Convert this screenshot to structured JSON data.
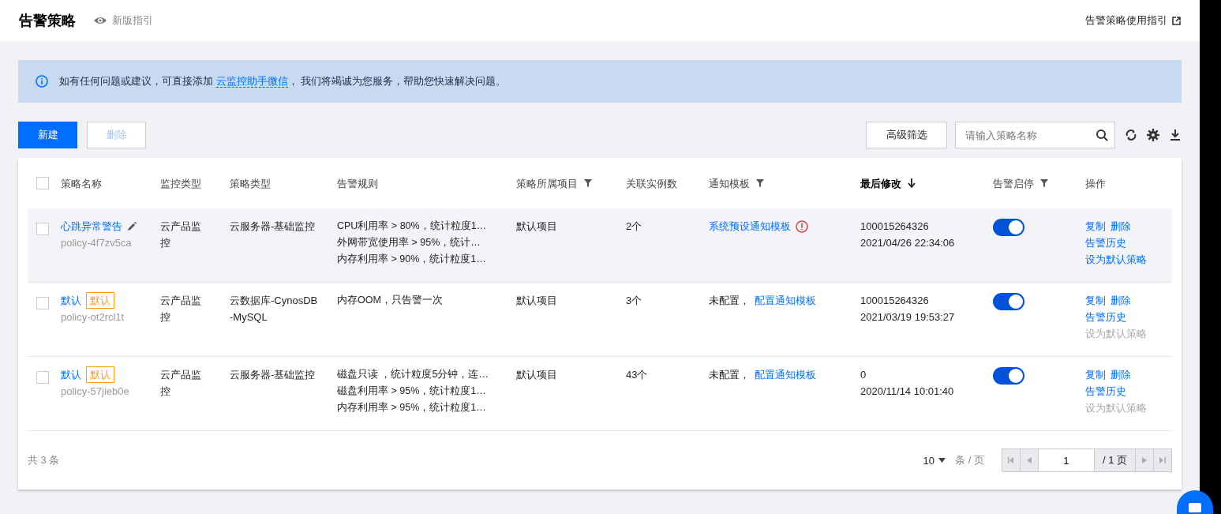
{
  "header": {
    "title": "告警策略",
    "guide_link": "新版指引",
    "help_link": "告警策略使用指引"
  },
  "notice": {
    "before": "如有任何问题或建议，可直接添加",
    "link": "云监控助手微信",
    "after": "，  我们将竭诚为您服务，帮助您快速解决问题。"
  },
  "toolbar": {
    "create": "新建",
    "delete": {
      "label": "删除",
      "disabled": true
    },
    "filter": "高级筛选",
    "search": {
      "placeholder": "请输入策略名称"
    }
  },
  "table": {
    "all_checked": false,
    "columns": [
      {
        "label": "策略名称",
        "kind": "plain"
      },
      {
        "label": "监控类型",
        "kind": "plain"
      },
      {
        "label": "策略类型",
        "kind": "plain"
      },
      {
        "label": "告警规则",
        "kind": "plain"
      },
      {
        "label": "策略所属项目",
        "kind": "filter"
      },
      {
        "label": "关联实例数",
        "kind": "plain"
      },
      {
        "label": "通知模板",
        "kind": "filter"
      },
      {
        "label": "最后修改",
        "kind": "sort"
      },
      {
        "label": "告警启停",
        "kind": "filter"
      },
      {
        "label": "操作",
        "kind": "plain"
      }
    ],
    "rows": [
      {
        "hovered": true,
        "checked": false,
        "name": "心跳异常警告",
        "editable": true,
        "id": "policy-4f7zv5ca",
        "monitor_type": "云产品监控",
        "policy_type": "云服务器-基础监控",
        "rules": [
          "CPU利用率 > 80%，统计粒度1…",
          "外网带宽使用率 > 95%，统计…",
          "内存利用率 > 90%，统计粒度1…"
        ],
        "project": "默认项目",
        "instances": "2个",
        "template": {
          "link": "系统预设通知模板",
          "warning": true
        },
        "modifier": "100015264326",
        "modified": "2021/04/26 22:34:06",
        "enabled": true,
        "actions": {
          "copy": "复制",
          "delete": "删除",
          "history": "告警历史",
          "set_default": {
            "label": "设为默认策略",
            "disabled": false
          }
        }
      },
      {
        "hovered": false,
        "checked": false,
        "name": "默认",
        "tag": "默认",
        "id": "policy-ot2rcl1t",
        "monitor_type": "云产品监控",
        "policy_type": "云数据库-CynosDB-MySQL",
        "rules": [
          "内存OOM，只告警一次"
        ],
        "project": "默认项目",
        "instances": "3个",
        "template": {
          "prefix": "未配置，",
          "link": "配置通知模板"
        },
        "modifier": "100015264326",
        "modified": "2021/03/19 19:53:27",
        "enabled": true,
        "actions": {
          "copy": "复制",
          "delete": "删除",
          "history": "告警历史",
          "set_default": {
            "label": "设为默认策略",
            "disabled": true
          }
        }
      },
      {
        "hovered": false,
        "checked": false,
        "name": "默认",
        "tag": "默认",
        "id": "policy-57jieb0e",
        "monitor_type": "云产品监控",
        "policy_type": "云服务器-基础监控",
        "rules": [
          "磁盘只读 ，统计粒度5分钟，连…",
          "磁盘利用率 > 95%，统计粒度1…",
          "内存利用率 > 95%，统计粒度1…"
        ],
        "project": "默认项目",
        "instances": "43个",
        "template": {
          "prefix": "未配置，",
          "link": "配置通知模板"
        },
        "modifier": "0",
        "modified": "2020/11/14 10:01:40",
        "enabled": true,
        "actions": {
          "copy": "复制",
          "delete": "删除",
          "history": "告警历史",
          "set_default": {
            "label": "设为默认策略",
            "disabled": true
          }
        }
      }
    ]
  },
  "pagination": {
    "total": "共 3 条",
    "page_size": "10",
    "per_page": "条 / 页",
    "page": "1",
    "pages": "/ 1 页"
  }
}
